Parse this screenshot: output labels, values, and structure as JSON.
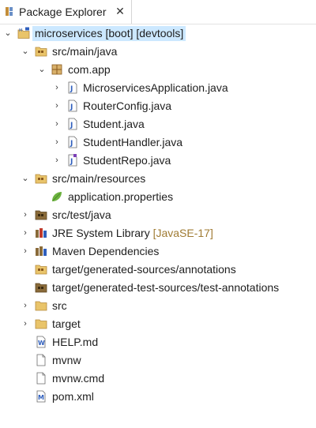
{
  "header": {
    "title": "Package Explorer",
    "close_glyph": "✕"
  },
  "tree": {
    "project": {
      "label": "microservices [boot] [devtools]",
      "icon": "java-project-icon"
    },
    "items": [
      {
        "label": "src/main/java",
        "icon": "source-folder-icon"
      },
      {
        "label": "com.app",
        "icon": "package-icon"
      },
      {
        "label": "MicroservicesApplication.java",
        "icon": "java-file-icon"
      },
      {
        "label": "RouterConfig.java",
        "icon": "java-file-icon"
      },
      {
        "label": "Student.java",
        "icon": "java-file-icon"
      },
      {
        "label": "StudentHandler.java",
        "icon": "java-file-icon"
      },
      {
        "label": "StudentRepo.java",
        "icon": "java-interface-file-icon"
      },
      {
        "label": "src/main/resources",
        "icon": "source-folder-icon"
      },
      {
        "label": "application.properties",
        "icon": "spring-leaf-icon"
      },
      {
        "label": "src/test/java",
        "icon": "source-folder-icon"
      },
      {
        "label": "JRE System Library",
        "decoration": "[JavaSE-17]",
        "icon": "library-icon"
      },
      {
        "label": "Maven Dependencies",
        "icon": "library-icon"
      },
      {
        "label": "target/generated-sources/annotations",
        "icon": "source-folder-icon"
      },
      {
        "label": "target/generated-test-sources/test-annotations",
        "icon": "source-folder-icon"
      },
      {
        "label": "src",
        "icon": "folder-icon"
      },
      {
        "label": "target",
        "icon": "folder-icon"
      },
      {
        "label": "HELP.md",
        "icon": "markdown-file-icon"
      },
      {
        "label": "mvnw",
        "icon": "file-icon"
      },
      {
        "label": "mvnw.cmd",
        "icon": "file-icon"
      },
      {
        "label": "pom.xml",
        "icon": "xml-file-icon"
      }
    ]
  },
  "colors": {
    "selection": "#cce8ff",
    "folder": "#e9c46a",
    "package": "#b58a3c",
    "java_icon_blue": "#2f5fbd",
    "library": "#8a6b3a",
    "decoration": "#a07b33",
    "spring_leaf": "#6db33f"
  }
}
